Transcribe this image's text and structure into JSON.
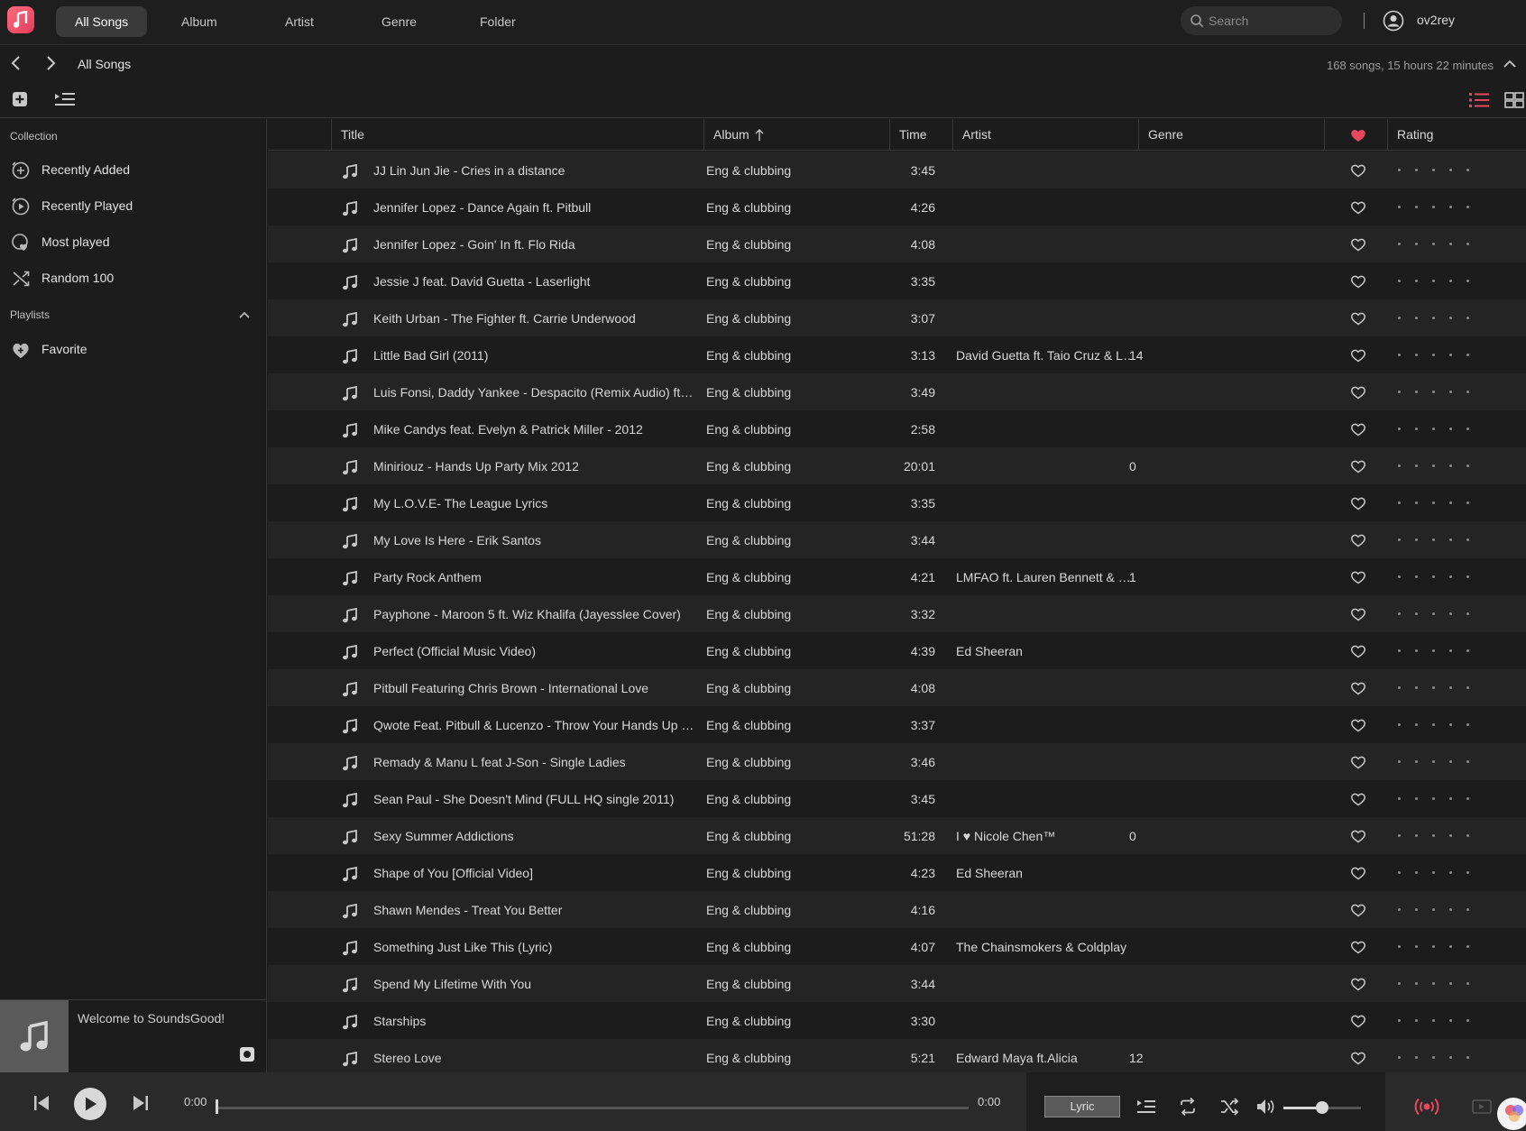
{
  "topbar": {
    "tabs": [
      {
        "label": "All Songs",
        "active": true
      },
      {
        "label": "Album",
        "active": false
      },
      {
        "label": "Artist",
        "active": false
      },
      {
        "label": "Genre",
        "active": false
      },
      {
        "label": "Folder",
        "active": false
      }
    ],
    "search_placeholder": "Search",
    "username": "ov2rey"
  },
  "breadcrumb": "All Songs",
  "summary": "168 songs, 15 hours 22 minutes",
  "sidebar": {
    "collection_label": "Collection",
    "collection_items": [
      {
        "label": "Recently Added",
        "icon": "clock-plus-icon"
      },
      {
        "label": "Recently Played",
        "icon": "clock-play-icon"
      },
      {
        "label": "Most played",
        "icon": "heart-clock-icon"
      },
      {
        "label": "Random 100",
        "icon": "shuffle-icon"
      }
    ],
    "playlists_label": "Playlists",
    "playlists": [
      {
        "label": "Favorite",
        "icon": "heart-plus-icon"
      }
    ],
    "now_playing_text": "Welcome to SoundsGood!"
  },
  "table": {
    "headers": {
      "title": "Title",
      "album": "Album",
      "time": "Time",
      "artist": "Artist",
      "genre": "Genre",
      "rating": "Rating"
    },
    "rows": [
      {
        "title": "JJ Lin Jun Jie - Cries in a distance",
        "album": "Eng & clubbing",
        "time": "3:45",
        "artist": "",
        "genre": ""
      },
      {
        "title": "Jennifer Lopez - Dance Again ft. Pitbull",
        "album": "Eng & clubbing",
        "time": "4:26",
        "artist": "",
        "genre": ""
      },
      {
        "title": "Jennifer Lopez - Goin' In ft. Flo Rida",
        "album": "Eng & clubbing",
        "time": "4:08",
        "artist": "",
        "genre": ""
      },
      {
        "title": "Jessie J feat. David Guetta - Laserlight",
        "album": "Eng & clubbing",
        "time": "3:35",
        "artist": "",
        "genre": ""
      },
      {
        "title": "Keith Urban - The Fighter ft. Carrie Underwood",
        "album": "Eng & clubbing",
        "time": "3:07",
        "artist": "",
        "genre": ""
      },
      {
        "title": "Little Bad Girl (2011)",
        "album": "Eng & clubbing",
        "time": "3:13",
        "artist": "David Guetta ft. Taio Cruz & Lu...",
        "genre": "14"
      },
      {
        "title": "Luis Fonsi, Daddy Yankee - Despacito (Remix Audio) ft. Ju...",
        "album": "Eng & clubbing",
        "time": "3:49",
        "artist": "",
        "genre": ""
      },
      {
        "title": "Mike Candys feat. Evelyn & Patrick Miller - 2012",
        "album": "Eng & clubbing",
        "time": "2:58",
        "artist": "",
        "genre": ""
      },
      {
        "title": "Miniriouz - Hands Up Party Mix 2012",
        "album": "Eng & clubbing",
        "time": "20:01",
        "artist": "",
        "genre": "0"
      },
      {
        "title": "My L.O.V.E- The League Lyrics",
        "album": "Eng & clubbing",
        "time": "3:35",
        "artist": "",
        "genre": ""
      },
      {
        "title": "My Love Is Here - Erik Santos",
        "album": "Eng & clubbing",
        "time": "3:44",
        "artist": "",
        "genre": ""
      },
      {
        "title": "Party Rock Anthem",
        "album": "Eng & clubbing",
        "time": "4:21",
        "artist": "LMFAO ft. Lauren Bennett & Goo",
        "genre": "1"
      },
      {
        "title": "Payphone - Maroon 5 ft. Wiz Khalifa (Jayesslee Cover)",
        "album": "Eng & clubbing",
        "time": "3:32",
        "artist": "",
        "genre": ""
      },
      {
        "title": "Perfect (Official Music Video)",
        "album": "Eng & clubbing",
        "time": "4:39",
        "artist": "Ed Sheeran",
        "genre": ""
      },
      {
        "title": "Pitbull Featuring Chris Brown - International Love",
        "album": "Eng & clubbing",
        "time": "4:08",
        "artist": "",
        "genre": ""
      },
      {
        "title": "Qwote Feat. Pitbull & Lucenzo - Throw Your Hands Up (D...",
        "album": "Eng & clubbing",
        "time": "3:37",
        "artist": "",
        "genre": ""
      },
      {
        "title": "Remady & Manu L feat J-Son - Single Ladies",
        "album": "Eng & clubbing",
        "time": "3:46",
        "artist": "",
        "genre": ""
      },
      {
        "title": "Sean Paul - She Doesn't Mind (FULL HQ single 2011)",
        "album": "Eng & clubbing",
        "time": "3:45",
        "artist": "",
        "genre": ""
      },
      {
        "title": "Sexy Summer Addictions",
        "album": "Eng & clubbing",
        "time": "51:28",
        "artist": "I ♥ Nicole Chen™",
        "genre": "0"
      },
      {
        "title": "Shape of You [Official Video]",
        "album": "Eng & clubbing",
        "time": "4:23",
        "artist": "Ed Sheeran",
        "genre": ""
      },
      {
        "title": "Shawn Mendes - Treat You Better",
        "album": "Eng & clubbing",
        "time": "4:16",
        "artist": "",
        "genre": ""
      },
      {
        "title": "Something Just Like This (Lyric)",
        "album": "Eng & clubbing",
        "time": "4:07",
        "artist": "The Chainsmokers & Coldplay",
        "genre": ""
      },
      {
        "title": "Spend My Lifetime With You",
        "album": "Eng & clubbing",
        "time": "3:44",
        "artist": "",
        "genre": ""
      },
      {
        "title": "Starships",
        "album": "Eng & clubbing",
        "time": "3:30",
        "artist": "",
        "genre": ""
      },
      {
        "title": "Stereo Love",
        "album": "Eng & clubbing",
        "time": "5:21",
        "artist": "Edward Maya ft.Alicia",
        "genre": "12"
      }
    ]
  },
  "player": {
    "current_time": "0:00",
    "total_time": "0:00",
    "lyric_label": "Lyric",
    "progress": 0,
    "volume": 0.5
  },
  "colors": {
    "accent": "#e8485f",
    "background": "#1c1c1c",
    "row_alt": "#242424"
  }
}
